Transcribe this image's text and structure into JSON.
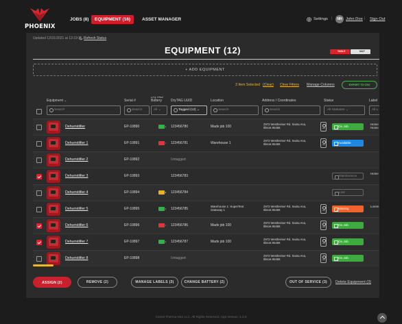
{
  "app": {
    "logo_text": "PHOENIX"
  },
  "nav": {
    "jobs": "JOBS (8)",
    "equipment": "EQUIPMENT (16)",
    "asset_manager": "ASSET MANAGER"
  },
  "user": {
    "settings": "Settings",
    "initials": "NH",
    "name": "John Doe",
    "signout": "Sign Out"
  },
  "page": {
    "updated": "Updated 12/31/2021 at 13:19:11",
    "refresh": "Refresh Status",
    "title": "EQUIPMENT (12)",
    "view_table": "TABLE",
    "view_map": "MAP",
    "add": "+ ADD EQUIPMENT",
    "selected": "3 Item Selected",
    "clear": "(Clear)",
    "clear_filters": "Clear Filters",
    "manage_columns": "Manage Columns",
    "export": "EXPORT TO CSV"
  },
  "columns": {
    "equipment": "Equipment",
    "serial": "Serial #",
    "drytag_battery": "DryTAG Battery",
    "uuid": "DryTAG UUID",
    "location": "Location",
    "address": "Address / Coordinates",
    "status": "Status",
    "labels": "Label"
  },
  "filters": {
    "search": "Search",
    "all": "All",
    "tagged": "Tagged (12)",
    "all_statuses": "All Statuses",
    "all_labels": "All L"
  },
  "rows": [
    {
      "name": "Dehumidifier",
      "serial": "EP-10890",
      "uuid": "123456780",
      "location": "Madv job 100",
      "addr1": "2972 Westheimer Rd. Santa Ana,",
      "addr2": "Illinois 85486",
      "status": "On Job",
      "label1": "Home",
      "label2": "Home",
      "checked": false,
      "battery": "green"
    },
    {
      "name": "Dehumidifier 1",
      "serial": "EP-10891",
      "uuid": "123456781",
      "location": "Warehouse 1",
      "addr1": "2972 Westheimer Rd. Santa Ana,",
      "addr2": "Illinois 85486",
      "status": "Available",
      "label1": "",
      "label2": "",
      "checked": false,
      "battery": "red"
    },
    {
      "name": "Dehumidifier 2",
      "serial": "EP-10892",
      "uuid": "Untagged",
      "location": "",
      "addr1": "",
      "addr2": "",
      "status": "",
      "label1": "",
      "label2": "",
      "checked": false,
      "battery": ""
    },
    {
      "name": "Dehumidifier 3",
      "serial": "EP-10893",
      "uuid": "123456783",
      "location": "",
      "addr1": "",
      "addr2": "",
      "status": "Maintenance",
      "label1": "Home",
      "label2": "",
      "checked": true,
      "battery": ""
    },
    {
      "name": "Dehumidifier 4",
      "serial": "EP-10894",
      "uuid": "123456784",
      "location": "",
      "addr1": "",
      "addr2": "",
      "status": "Lost",
      "label1": "",
      "label2": "",
      "checked": false,
      "battery": "yellow"
    },
    {
      "name": "Dehumidifier 5",
      "serial": "EP-10895",
      "uuid": "123456785",
      "location": "Warehouse 1: SuperTest",
      "location2": "Gateway 1",
      "addr1": "2972 Westheimer Rd. Santa Ana,",
      "addr2": "Illinois 85486",
      "status": "Missing",
      "label1": "Lorem",
      "label2": "",
      "checked": false,
      "battery": "green"
    },
    {
      "name": "Dehumidifier 6",
      "serial": "EP-10896",
      "uuid": "123456786",
      "location": "Madv job 100",
      "addr1": "2972 Westheimer Rd. Santa Ana,",
      "addr2": "Illinois 85486",
      "status": "On Job",
      "label1": "",
      "label2": "",
      "checked": true,
      "battery": "red"
    },
    {
      "name": "Dehumidifier 7",
      "serial": "EP-10897",
      "uuid": "123456787",
      "location": "Madv job 100",
      "addr1": "2972 Westheimer Rd. Santa Ana,",
      "addr2": "Illinois 85486",
      "status": "On Job",
      "label1": "",
      "label2": "",
      "checked": true,
      "battery": "green"
    },
    {
      "name": "Dehumidifier 8",
      "serial": "EP-10898",
      "uuid": "Untagged",
      "location": "",
      "addr1": "2972 Westheimer Rd. Santa Ana,",
      "addr2": "Illinois 85486",
      "status": "On Job",
      "label1": "",
      "label2": "",
      "checked": false,
      "battery": ""
    }
  ],
  "actions": {
    "assign": "ASSIGN (2)",
    "remove": "REMOVE (2)",
    "manage_labels": "MANAGE LABELS (3)",
    "change_battery": "CHANGE BATTERY (2)",
    "out_of_service": "OUT OF SERVICE (3)",
    "delete": "Delete Equipment (3)"
  },
  "footer": "©2022 Therma-Stor LLC. All Rights Reserved. App Version: 2.3.0",
  "colors": {
    "brand_red": "#cf1d2b",
    "status_green": "#3faa3f",
    "status_blue": "#1e88e5",
    "status_orange": "#f0642c",
    "battery_green": "#31b24a",
    "battery_red": "#e2343b",
    "battery_yellow": "#e9b125"
  }
}
